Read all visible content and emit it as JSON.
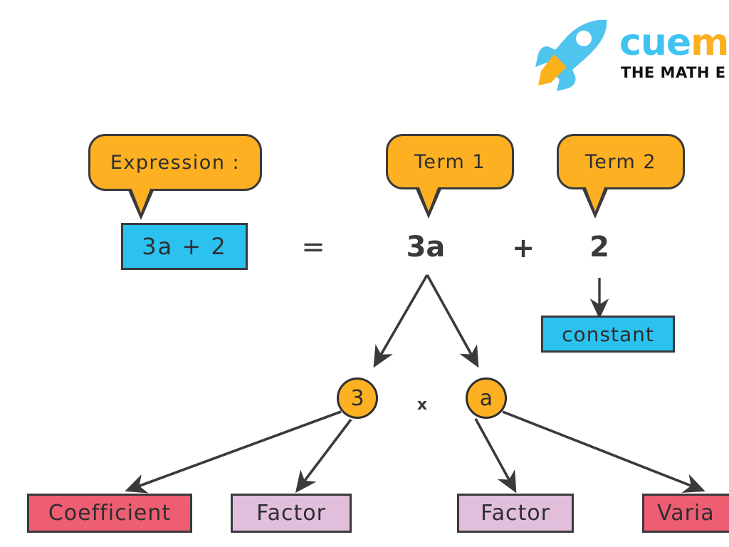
{
  "logo": {
    "icon": "rocket-icon",
    "word_part1": "cue",
    "word_part2": "ma",
    "tagline": "THE MATH E",
    "cyan": "#3FC3F0",
    "orange": "#FCB022"
  },
  "diagram": {
    "title_callouts": [
      {
        "id": "expression",
        "label": "Expression :"
      },
      {
        "id": "term1",
        "label": "Term 1"
      },
      {
        "id": "term2",
        "label": "Term 2"
      }
    ],
    "expression_box": {
      "label": "3a + 2",
      "color": "#2BC2F0"
    },
    "equals_sign": "=",
    "terms": [
      {
        "id": "term1-value",
        "label": "3a"
      },
      {
        "id": "plus-operator",
        "label": "+"
      },
      {
        "id": "term2-value",
        "label": "2"
      }
    ],
    "constant_box": {
      "label": "constant",
      "color": "#2BC2F0"
    },
    "factors": [
      {
        "id": "factor-3",
        "label": "3"
      },
      {
        "id": "multiply-operator",
        "label": "x"
      },
      {
        "id": "factor-a",
        "label": "a"
      }
    ],
    "result_boxes": [
      {
        "id": "coefficient",
        "label": "Coefficient",
        "color": "#EE5E72"
      },
      {
        "id": "factor-left",
        "label": "Factor",
        "color": "#E0BEDC"
      },
      {
        "id": "factor-right",
        "label": "Factor",
        "color": "#E0BEDC"
      },
      {
        "id": "variable",
        "label": "Varia",
        "color": "#EE5E72"
      }
    ],
    "line_color": "#3A3A3C"
  }
}
